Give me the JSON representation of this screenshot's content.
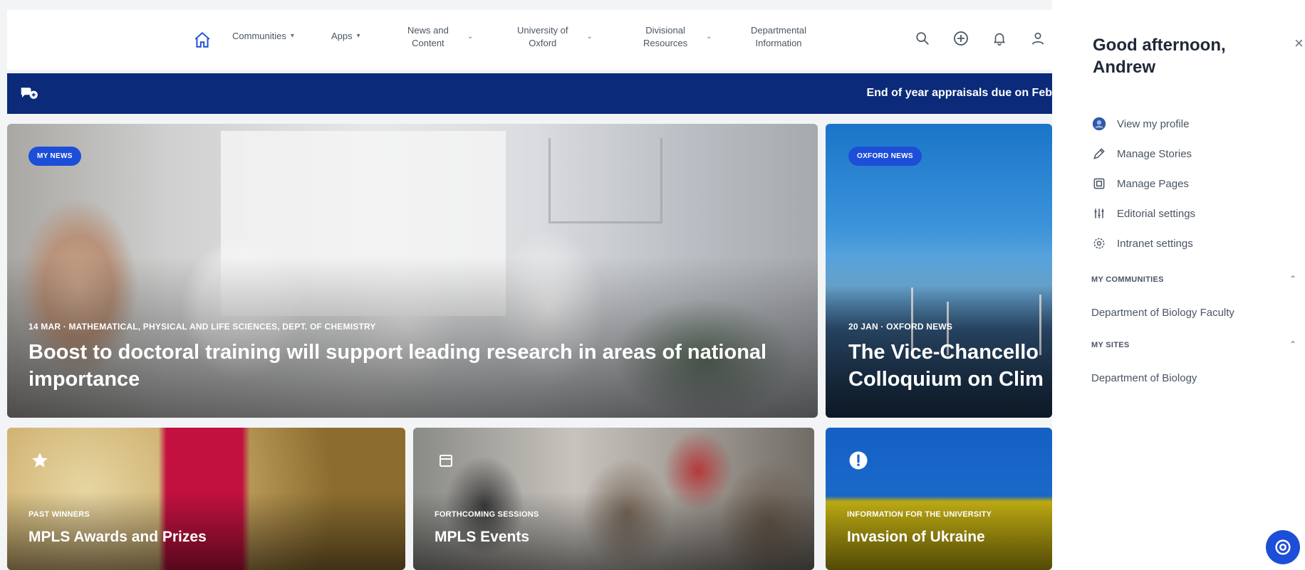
{
  "nav": {
    "home_icon": "home-icon",
    "items": [
      {
        "label": "Communities",
        "chevron": "▾"
      },
      {
        "label": "Apps",
        "chevron": "▾"
      },
      {
        "label": "News and\nContent",
        "chevron": "⌄"
      },
      {
        "label": "University of\nOxford",
        "chevron": "⌄"
      },
      {
        "label": "Divisional\nResources",
        "chevron": "⌄"
      },
      {
        "label": "Departmental\nInformation",
        "chevron": ""
      }
    ],
    "icons": [
      "search-icon",
      "add-icon",
      "notification-bell-icon",
      "user-icon"
    ]
  },
  "banner": {
    "text": "End of year appraisals due on Feb",
    "bg": "#0b2a7a"
  },
  "hero_main": {
    "badge": "MY NEWS",
    "meta": "14 MAR · MATHEMATICAL, PHYSICAL AND LIFE SCIENCES, DEPT. OF CHEMISTRY",
    "title": "Boost to doctoral training will support leading research in areas of national importance"
  },
  "hero_right": {
    "badge": "OXFORD NEWS",
    "meta": "20 JAN · OXFORD NEWS",
    "title_line1": "The Vice-Chancello",
    "title_line2": "Colloquium on Clim"
  },
  "tiles": [
    {
      "meta": "PAST WINNERS",
      "title": "MPLS Awards and Prizes",
      "icon": "star-icon"
    },
    {
      "meta": "FORTHCOMING SESSIONS",
      "title": "MPLS Events",
      "icon": "calendar-icon"
    },
    {
      "meta": "INFORMATION FOR THE UNIVERSITY",
      "title": "Invasion of Ukraine",
      "icon": "alert-icon"
    }
  ],
  "panel": {
    "greeting": "Good afternoon, Andrew",
    "close": "×",
    "menu": [
      {
        "label": "View my profile",
        "icon": "profile-icon"
      },
      {
        "label": "Manage Stories",
        "icon": "pen-icon"
      },
      {
        "label": "Manage Pages",
        "icon": "pages-icon"
      },
      {
        "label": "Editorial settings",
        "icon": "sliders-icon"
      },
      {
        "label": "Intranet settings",
        "icon": "gear-icon"
      }
    ],
    "my_communities_label": "MY COMMUNITIES",
    "my_communities": [
      "Department of Biology Faculty"
    ],
    "my_sites_label": "MY SITES",
    "my_sites": [
      "Department of Biology"
    ],
    "chevron": "⌃"
  },
  "colors": {
    "accent": "#1d4ed8",
    "banner": "#0b2a7a"
  }
}
